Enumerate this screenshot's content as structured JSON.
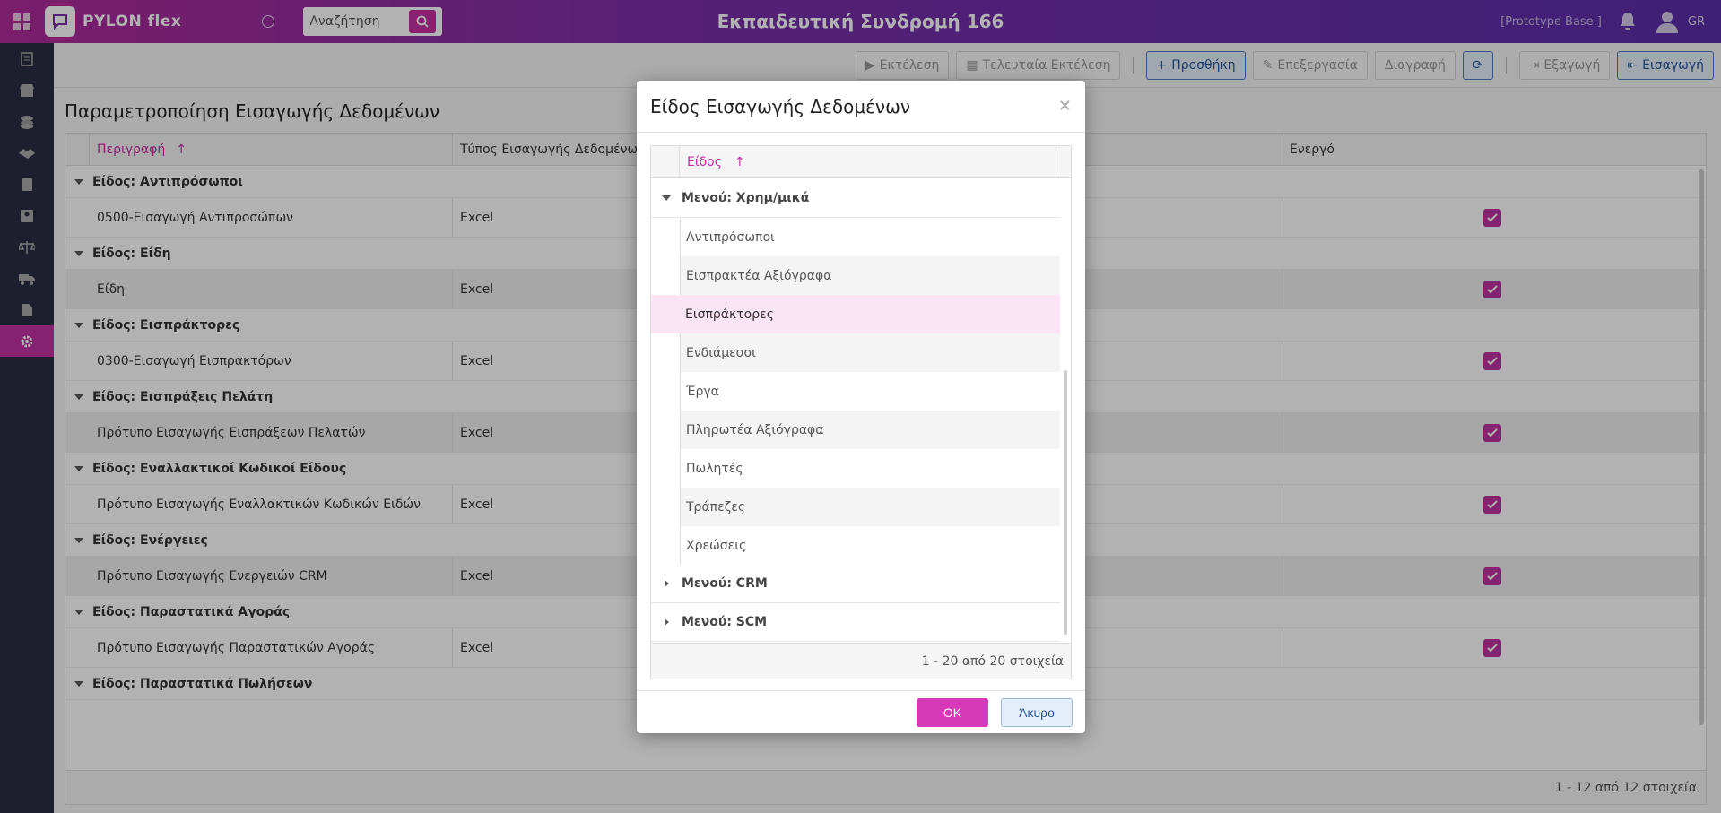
{
  "app": {
    "logo_text": "PYLON flex",
    "title": "Εκπαιδευτική Συνδρομή 166",
    "base_label": "[Prototype Base.]",
    "lang": "GR",
    "search_placeholder": "Αναζήτηση"
  },
  "toolbar": {
    "run": "Εκτέλεση",
    "last_run": "Τελευταία Εκτέλεση",
    "add": "Προσθήκη",
    "edit": "Επεξεργασία",
    "delete": "Διαγραφή",
    "export": "Εξαγωγή",
    "import": "Εισαγωγή"
  },
  "page": {
    "title": "Παραμετροποίηση Εισαγωγής Δεδομένων",
    "columns": [
      "Περιγραφή",
      "Τύπος Εισαγωγής Δεδομένων",
      "Ενεργό"
    ],
    "groups": [
      {
        "label": "Είδος: Αντιπρόσωποι",
        "row": {
          "desc": "0500-Εισαγωγή Αντιπροσώπων",
          "type": "Excel"
        }
      },
      {
        "label": "Είδος: Είδη",
        "row": {
          "desc": "Είδη",
          "type": "Excel"
        }
      },
      {
        "label": "Είδος: Εισπράκτορες",
        "row": {
          "desc": "0300-Εισαγωγή Εισπρακτόρων",
          "type": "Excel"
        }
      },
      {
        "label": "Είδος: Εισπράξεις Πελάτη",
        "row": {
          "desc": "Πρότυπο Εισαγωγής Εισπράξεων Πελατών",
          "type": "Excel"
        }
      },
      {
        "label": "Είδος: Εναλλακτικοί Κωδικοί Είδους",
        "row": {
          "desc": "Πρότυπο Εισαγωγής Εναλλακτικών Κωδικών Ειδών",
          "type": "Excel"
        }
      },
      {
        "label": "Είδος: Ενέργειες",
        "row": {
          "desc": "Πρότυπο Εισαγωγής Ενεργειών CRM",
          "type": "Excel"
        }
      },
      {
        "label": "Είδος: Παραστατικά Αγοράς",
        "row": {
          "desc": "Πρότυπο Εισαγωγής Παραστατικών Αγοράς",
          "type": "Excel"
        }
      },
      {
        "label": "Είδος: Παραστατικά Πωλήσεων",
        "row": {
          "desc": "",
          "type": ""
        }
      }
    ],
    "footer": "1 - 12 από 12 στοιχεία"
  },
  "modal": {
    "title": "Είδος Εισαγωγής Δεδομένων",
    "column": "Είδος",
    "group_open": "Μενού: Χρημ/μικά",
    "items": [
      "Αντιπρόσωποι",
      "Εισπρακτέα Αξιόγραφα",
      "Εισπράκτορες",
      "Ενδιάμεσοι",
      "Έργα",
      "Πληρωτέα Αξιόγραφα",
      "Πωλητές",
      "Τράπεζες",
      "Χρεώσεις"
    ],
    "selected_index": 2,
    "group_crm": "Μενού: CRM",
    "group_scm": "Μενού: SCM",
    "footer": "1 - 20 από 20 στοιχεία",
    "ok": "OK",
    "cancel": "Άκυρο"
  },
  "colors": {
    "accent": "#c0329f",
    "primary_blue": "#2b5797",
    "sidebar": "#2b2d42"
  }
}
